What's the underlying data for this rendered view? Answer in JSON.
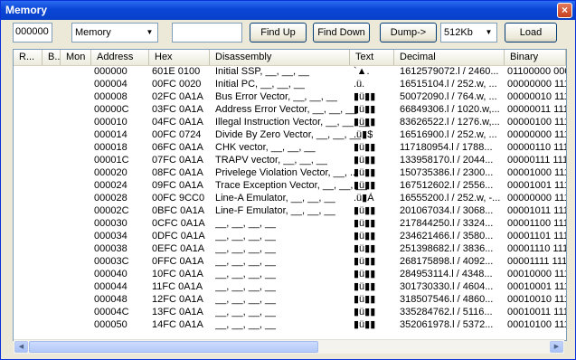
{
  "window": {
    "title": "Memory",
    "close_label": "×"
  },
  "toolbar": {
    "address_value": "000000",
    "memory_select": "Memory",
    "find_value": "",
    "find_up": "Find Up",
    "find_down": "Find Down",
    "dump": "Dump->",
    "size_select": "512Kb",
    "load": "Load"
  },
  "columns": [
    "R...",
    "B...",
    "Mon",
    "Address",
    "Hex",
    "Disassembly",
    "Text",
    "Decimal",
    "Binary"
  ],
  "rows": [
    {
      "address": "000000",
      "hex": "601E 0100",
      "dis": "Initial SSP, __, __, __",
      "text": "`▲.",
      "dec": "1612579072.l  /  2460...",
      "bin": "01100000 000"
    },
    {
      "address": "000004",
      "hex": "00FC 0020",
      "dis": "Initial PC, __, __, __",
      "text": ".ü. ",
      "dec": "16515104.l  /  252.w, ...",
      "bin": "00000000 111"
    },
    {
      "address": "000008",
      "hex": "02FC 0A1A",
      "dis": "Bus Error Vector, __, __, __",
      "text": "▮ü▮▮",
      "dec": "50072090.l  /  764.w, ...",
      "bin": "00000010 111"
    },
    {
      "address": "00000C",
      "hex": "03FC 0A1A",
      "dis": "Address Error Vector, __, __, __",
      "text": "▮ü▮▮",
      "dec": "66849306.l  /  1020.w,...",
      "bin": "00000011 111"
    },
    {
      "address": "000010",
      "hex": "04FC 0A1A",
      "dis": "Illegal Instruction Vector, __, __, __",
      "text": "▮ü▮▮",
      "dec": "83626522.l  /  1276.w,...",
      "bin": "00000100 111"
    },
    {
      "address": "000014",
      "hex": "00FC 0724",
      "dis": "Divide By Zero Vector, __, __, __",
      "text": ".ü▮$",
      "dec": "16516900.l  /  252.w, ...",
      "bin": "00000000 111"
    },
    {
      "address": "000018",
      "hex": "06FC 0A1A",
      "dis": "CHK vector, __, __, __",
      "text": "▮ü▮▮",
      "dec": "117180954.l  /  1788...",
      "bin": "00000110 111"
    },
    {
      "address": "00001C",
      "hex": "07FC 0A1A",
      "dis": "TRAPV vector, __, __, __",
      "text": "▮ü▮▮",
      "dec": "133958170.l  /  2044...",
      "bin": "00000111 111"
    },
    {
      "address": "000020",
      "hex": "08FC 0A1A",
      "dis": "Privelege Violation Vector, __, ...",
      "text": "▮ü▮▮",
      "dec": "150735386.l  /  2300...",
      "bin": "00001000 111"
    },
    {
      "address": "000024",
      "hex": "09FC 0A1A",
      "dis": "Trace Exception Vector, __, __, __",
      "text": "▮ü▮▮",
      "dec": "167512602.l  /  2556...",
      "bin": "00001001 111"
    },
    {
      "address": "000028",
      "hex": "00FC 9CC0",
      "dis": "Line-A Emulator, __, __, __",
      "text": ".ü▮À",
      "dec": "16555200.l  /  252.w, -...",
      "bin": "00000000 111"
    },
    {
      "address": "00002C",
      "hex": "0BFC 0A1A",
      "dis": "Line-F Emulator, __, __, __",
      "text": "▮ü▮▮",
      "dec": "201067034.l  /  3068...",
      "bin": "00001011 111"
    },
    {
      "address": "000030",
      "hex": "0CFC 0A1A",
      "dis": "__, __, __, __",
      "text": "▮ü▮▮",
      "dec": "217844250.l  /  3324...",
      "bin": "00001100 111"
    },
    {
      "address": "000034",
      "hex": "0DFC 0A1A",
      "dis": "__, __, __, __",
      "text": "▮ü▮▮",
      "dec": "234621466.l  /  3580...",
      "bin": "00001101 111"
    },
    {
      "address": "000038",
      "hex": "0EFC 0A1A",
      "dis": "__, __, __, __",
      "text": "▮ü▮▮",
      "dec": "251398682.l  /  3836...",
      "bin": "00001110 111"
    },
    {
      "address": "00003C",
      "hex": "0FFC 0A1A",
      "dis": "__, __, __, __",
      "text": "▮ü▮▮",
      "dec": "268175898.l  /  4092...",
      "bin": "00001111 111"
    },
    {
      "address": "000040",
      "hex": "10FC 0A1A",
      "dis": "__, __, __, __",
      "text": "▮ü▮▮",
      "dec": "284953114.l  /  4348...",
      "bin": "00010000 111"
    },
    {
      "address": "000044",
      "hex": "11FC 0A1A",
      "dis": "__, __, __, __",
      "text": "▮ü▮▮",
      "dec": "301730330.l  /  4604...",
      "bin": "00010001 111"
    },
    {
      "address": "000048",
      "hex": "12FC 0A1A",
      "dis": "__, __, __, __",
      "text": "▮ü▮▮",
      "dec": "318507546.l  /  4860...",
      "bin": "00010010 111"
    },
    {
      "address": "00004C",
      "hex": "13FC 0A1A",
      "dis": "__, __, __, __",
      "text": "▮ü▮▮",
      "dec": "335284762.l  /  5116...",
      "bin": "00010011 111"
    },
    {
      "address": "000050",
      "hex": "14FC 0A1A",
      "dis": "__, __, __, __",
      "text": "▮ü▮▮",
      "dec": "352061978.l  /  5372...",
      "bin": "00010100 111"
    }
  ],
  "icons": {
    "combo_arrow": "down-arrow",
    "scroll_left": "left-arrow",
    "scroll_right": "right-arrow"
  }
}
